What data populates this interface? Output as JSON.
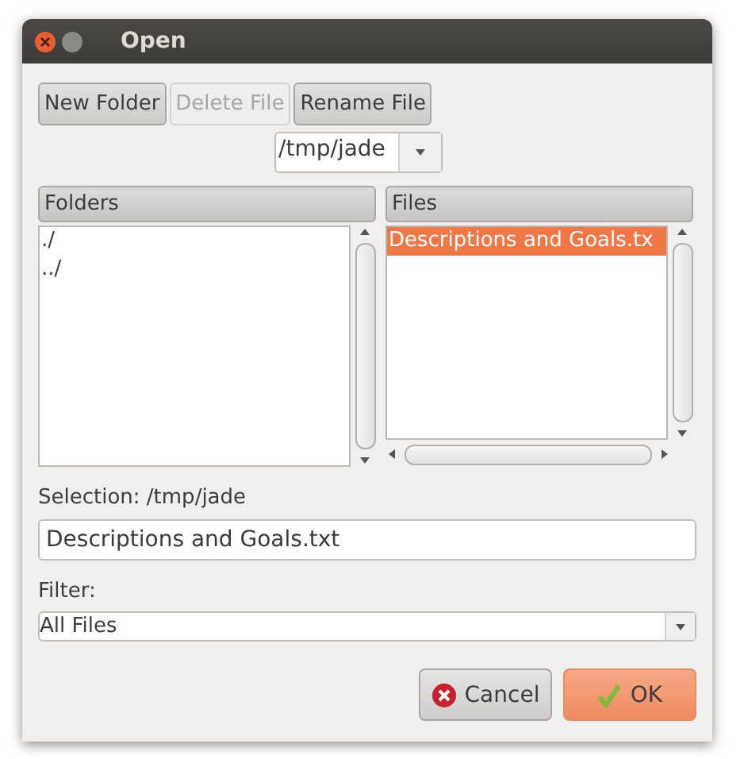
{
  "window": {
    "title": "Open"
  },
  "toolbar": [
    {
      "label": "New Folder",
      "disabled": false
    },
    {
      "label": "Delete File",
      "disabled": true
    },
    {
      "label": "Rename File",
      "disabled": false
    }
  ],
  "path_combo": {
    "value": "/tmp/jade"
  },
  "folders": {
    "header": "Folders",
    "items": [
      {
        "label": "./",
        "selected": false
      },
      {
        "label": "../",
        "selected": false
      }
    ]
  },
  "files": {
    "header": "Files",
    "items": [
      {
        "label": "Descriptions and Goals.tx",
        "selected": true
      }
    ]
  },
  "selection": {
    "label": "Selection: /tmp/jade",
    "value": "Descriptions and Goals.txt"
  },
  "filter": {
    "label": "Filter:",
    "value": "All Files"
  },
  "buttons": [
    {
      "label": "Cancel",
      "kind": "cancel"
    },
    {
      "label": "OK",
      "kind": "ok"
    }
  ]
}
